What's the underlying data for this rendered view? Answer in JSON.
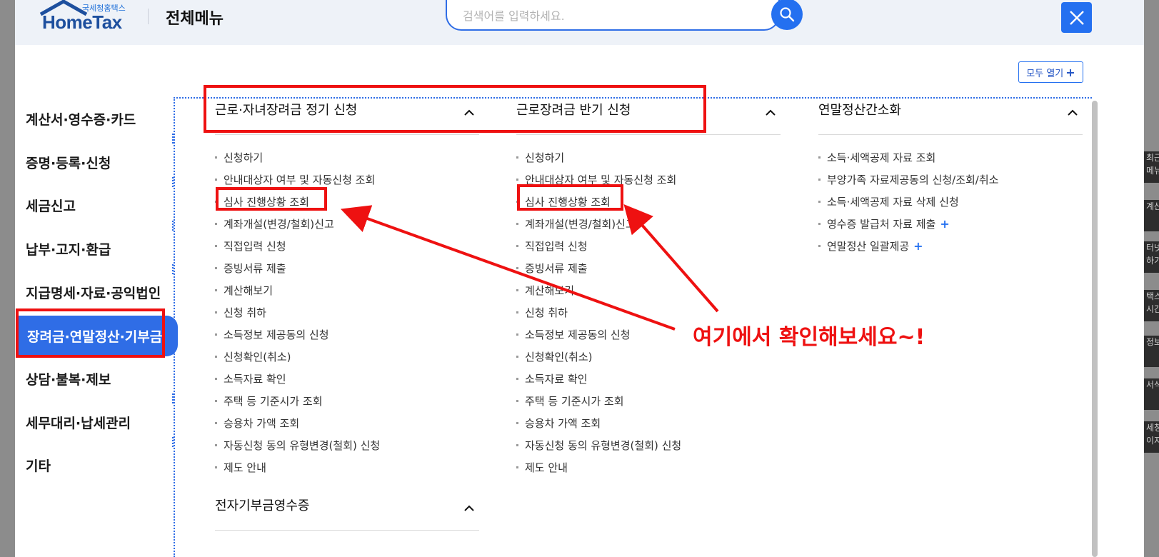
{
  "header": {
    "logo_sub": "국세청홈택스",
    "logo_brand": "HomeTax",
    "title": "전체메뉴",
    "search_placeholder": "검색어를 입력하세요.",
    "search_icon": "search-icon",
    "close_icon": "close-icon"
  },
  "toolbar": {
    "open_all_label": "모두 열기",
    "open_all_plus": "+"
  },
  "sidebar": {
    "items": [
      {
        "label": "계산서·영수증·카드"
      },
      {
        "label": "증명·등록·신청"
      },
      {
        "label": "세금신고"
      },
      {
        "label": "납부·고지·환급"
      },
      {
        "label": "지급명세·자료·공익법인"
      },
      {
        "label": "장려금·연말정산·기부금",
        "active": true
      },
      {
        "label": "상담·불복·제보"
      },
      {
        "label": "세무대리·납세관리"
      },
      {
        "label": "기타"
      }
    ]
  },
  "sections": [
    {
      "title": "근로·자녀장려금 정기 신청",
      "items": [
        "신청하기",
        "안내대상자 여부 및 자동신청 조회",
        "심사 진행상황 조회",
        "계좌개설(변경/철회)신고",
        "직접입력 신청",
        "증빙서류 제출",
        "계산해보기",
        "신청 취하",
        "소득정보 제공동의 신청",
        "신청확인(취소)",
        "소득자료 확인",
        "주택 등 기준시가 조회",
        "승용차 가액 조회",
        "자동신청 동의 유형변경(철회) 신청",
        "제도 안내"
      ]
    },
    {
      "title": "근로장려금 반기 신청",
      "items": [
        "신청하기",
        "안내대상자 여부 및 자동신청 조회",
        "심사 진행상황 조회",
        "계좌개설(변경/철회)신고",
        "직접입력 신청",
        "증빙서류 제출",
        "계산해보기",
        "신청 취하",
        "소득정보 제공동의 신청",
        "신청확인(취소)",
        "소득자료 확인",
        "주택 등 기준시가 조회",
        "승용차 가액 조회",
        "자동신청 동의 유형변경(철회) 신청",
        "제도 안내"
      ]
    },
    {
      "title": "연말정산간소화",
      "items": [
        "소득·세액공제 자료 조회",
        "부양가족 자료제공동의 신청/조회/취소",
        "소득·세액공제 자료 삭제 신청",
        "영수증 발급처 자료 제출",
        "연말정산 일괄제공"
      ],
      "expandable": [
        false,
        false,
        false,
        true,
        true
      ],
      "expand_symbol": "+"
    },
    {
      "title": "전자기부금영수증",
      "items": []
    }
  ],
  "annotation": {
    "text": "여기에서 확인해보세요~!",
    "color": "#ee1111"
  },
  "right_tabs": [
    "최근\n메뉴",
    "계산",
    "터넷\n하기",
    "택스\n시간",
    "정보",
    "서식",
    "세청\n이지"
  ],
  "colors": {
    "accent": "#2f6de6",
    "highlight_red": "#ee1111",
    "header_bg": "#eef2f8"
  }
}
